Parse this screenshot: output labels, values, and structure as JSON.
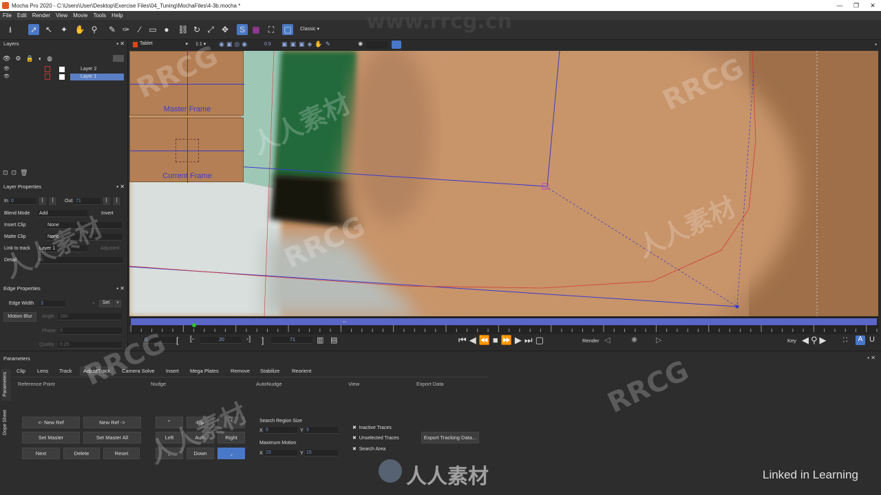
{
  "window": {
    "title": "Mocha Pro 2020 - C:\\Users\\User\\Desktop\\Exercise Files\\04_Tuning\\MochaFiles\\4-3b.mocha *"
  },
  "menu": [
    "File",
    "Edit",
    "Render",
    "View",
    "Movie",
    "Tools",
    "Help"
  ],
  "toolbar": {
    "workspace": "Classic"
  },
  "layers_panel": {
    "title": "Layers",
    "layers": [
      {
        "name": "Layer 2",
        "selected": false
      },
      {
        "name": "Layer 1",
        "selected": true
      }
    ]
  },
  "layer_properties": {
    "title": "Layer Properties",
    "in_label": "In",
    "in_value": "0",
    "out_label": "Out",
    "out_value": "71",
    "blend_mode_label": "Blend Mode",
    "blend_mode_value": "Add",
    "invert_label": "Invert",
    "insert_clip_label": "Insert Clip",
    "insert_clip_value": "None",
    "matte_clip_label": "Matte Clip",
    "matte_clip_value": "None",
    "link_to_track_label": "Link to track",
    "link_to_track_value": "Layer 1",
    "adjusted_label": "Adjusted",
    "detail_label": "Detail",
    "detail_value": "90"
  },
  "edge_properties": {
    "title": "Edge Properties",
    "edge_width_label": "Edge Width",
    "edge_width_value": "3",
    "set_label": "Set",
    "motion_blur_label": "Motion Blur",
    "angle_label": "Angle",
    "angle_value": "180",
    "phase_label": "Phase",
    "phase_value": "0",
    "quality_label": "Quality",
    "quality_value": "0.25"
  },
  "viewer": {
    "clip_name": "Tablet",
    "zoom": "1:1",
    "exposure": "0.5",
    "master_frame_label": "Master Frame",
    "current_frame_label": "Current Frame"
  },
  "transport": {
    "start_frame": "0",
    "current_frame": "20",
    "end_frame": "71",
    "render_label": "Render",
    "key_label": "Key"
  },
  "parameters": {
    "title": "Parameters",
    "side_tabs": [
      "Parameters",
      "Dope Sheet"
    ],
    "tabs": [
      "Clip",
      "Lens",
      "Track",
      "AdjustTrack",
      "Camera Solve",
      "Insert",
      "Mega Plates",
      "Remove",
      "Stabilize",
      "Reorient"
    ],
    "active_tab": "AdjustTrack",
    "sections": {
      "reference_point": "Reference Point",
      "nudge": "Nudge",
      "autonudge": "AutoNudge",
      "view": "View",
      "export_data": "Export Data"
    },
    "reference_buttons": [
      "<- New Ref",
      "New Ref ->",
      "Set Master",
      "Set Master All",
      "Next",
      "Delete",
      "Reset"
    ],
    "nudge": {
      "up": "Up",
      "left": "Left",
      "auto": "Auto",
      "right": "Right",
      "down": "Down"
    },
    "search_region_size": {
      "label": "Search Region Size",
      "x": "5",
      "y": "5"
    },
    "maximum_motion": {
      "label": "Maximum Motion",
      "x": "15",
      "y": "15"
    },
    "view_options": [
      {
        "label": "Inactive Traces",
        "checked": true
      },
      {
        "label": "Unselected Traces",
        "checked": true
      },
      {
        "label": "Search Area",
        "checked": true
      }
    ],
    "export_button": "Export Tracking Data..."
  },
  "overlay": {
    "watermark_site": "www.rrcg.cn",
    "watermark_brand": "RRCG",
    "watermark_cn": "人人素材",
    "linkedin_learning": "Linked in Learning"
  },
  "colors": {
    "accent": "#4a78c8",
    "track_line": "#3a3acc",
    "spline_red": "#d23a3a"
  }
}
